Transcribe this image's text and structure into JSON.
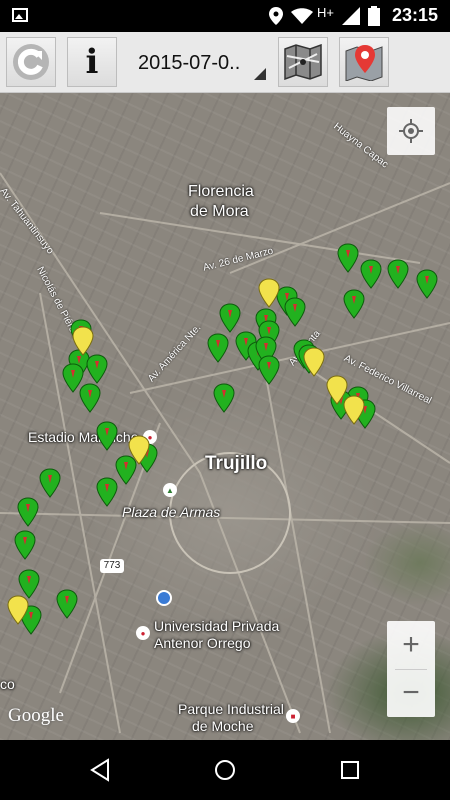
{
  "status_bar": {
    "time": "23:15",
    "network": "H+"
  },
  "toolbar": {
    "refresh_button": "refresh-icon",
    "info_label": "i",
    "date_value": "2015-07-0..",
    "map_type_button": "map-icon",
    "markers_button": "map-marker-icon"
  },
  "map": {
    "place_labels": {
      "florencia": "Florencia",
      "de_mora": "de Mora",
      "trujillo": "Trujillo",
      "estadio": "Estadio Mansiche",
      "plaza": "Plaza de Armas",
      "universidad_1": "Universidad Privada",
      "universidad_2": "Antenor Orrego",
      "parque_1": "Parque Industrial",
      "parque_2": "de Moche",
      "edge_fragment": "co"
    },
    "road_labels": {
      "tahuantinsuyo": "Av. Tahuantinsuyo",
      "nicolas": "Nicolás de Piérola",
      "huayna": "Huayna Capac",
      "marzo": "Av. 26 de Marzo",
      "america": "Av. América Nte.",
      "santa": "Av. Santa",
      "federico": "Av. Federico Villarreal",
      "shield": "773"
    },
    "attribution": "Google",
    "zoom_in": "+",
    "zoom_out": "−",
    "colors": {
      "green_pin": "#22b11f",
      "yellow_pin": "#f2e24c",
      "location_dot": "#3a7bd5"
    }
  },
  "nav_bar": {
    "back": "back-icon",
    "home": "home-icon",
    "recents": "recents-icon"
  }
}
